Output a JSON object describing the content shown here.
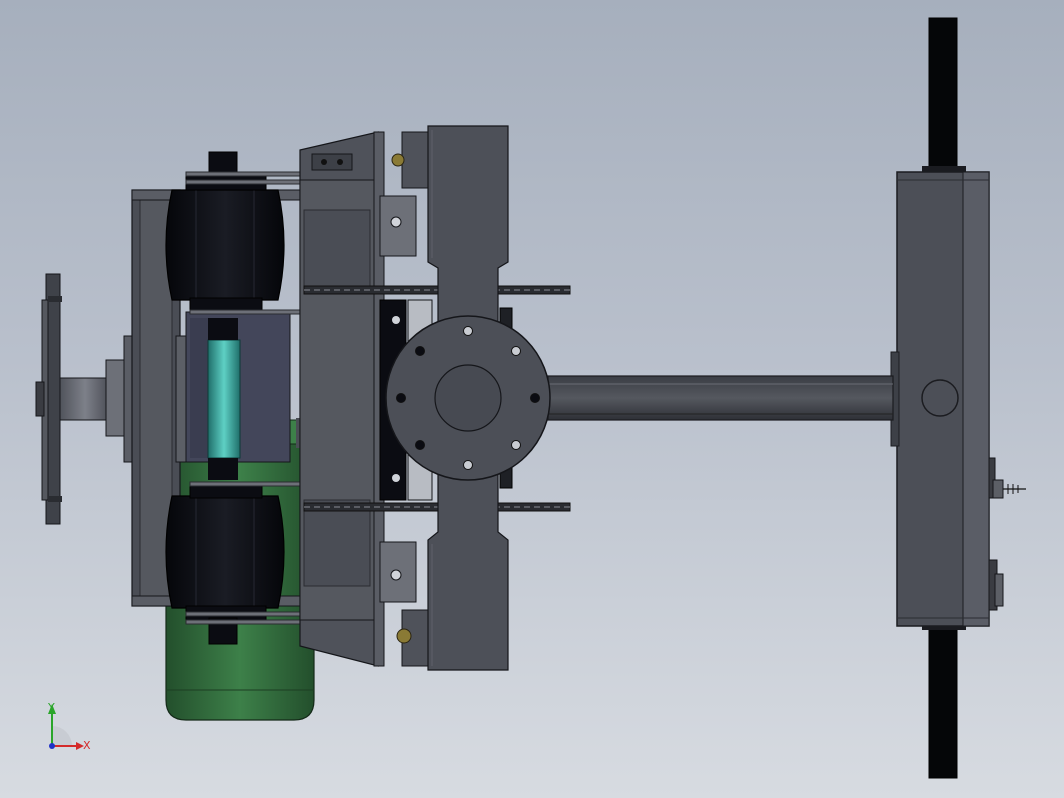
{
  "view": {
    "background_top": "#a6afbd",
    "background_bottom": "#d7dbe1"
  },
  "triad": {
    "x_label": "X",
    "y_label": "Y",
    "x_color": "#d42a2a",
    "y_color": "#2aa52a",
    "z_color": "#1f33c7"
  },
  "colors": {
    "housing": "#4a4d55",
    "housing_light": "#5a5d65",
    "tire": "#0b0c12",
    "motor": "#2e6b3a",
    "glass": "#2c8f8a",
    "bracket": "#c0c4cb",
    "bolt_gold": "#8a7a35"
  },
  "model": {
    "components": [
      "handwheel",
      "disc-brake",
      "tire-upper",
      "tire-lower",
      "drive-motor",
      "glass-roller",
      "side-frame",
      "chain-upper",
      "chain-lower",
      "carrier-arm",
      "flange-hub",
      "drive-shaft",
      "gearbox",
      "output-shaft",
      "sensor-probe"
    ]
  }
}
